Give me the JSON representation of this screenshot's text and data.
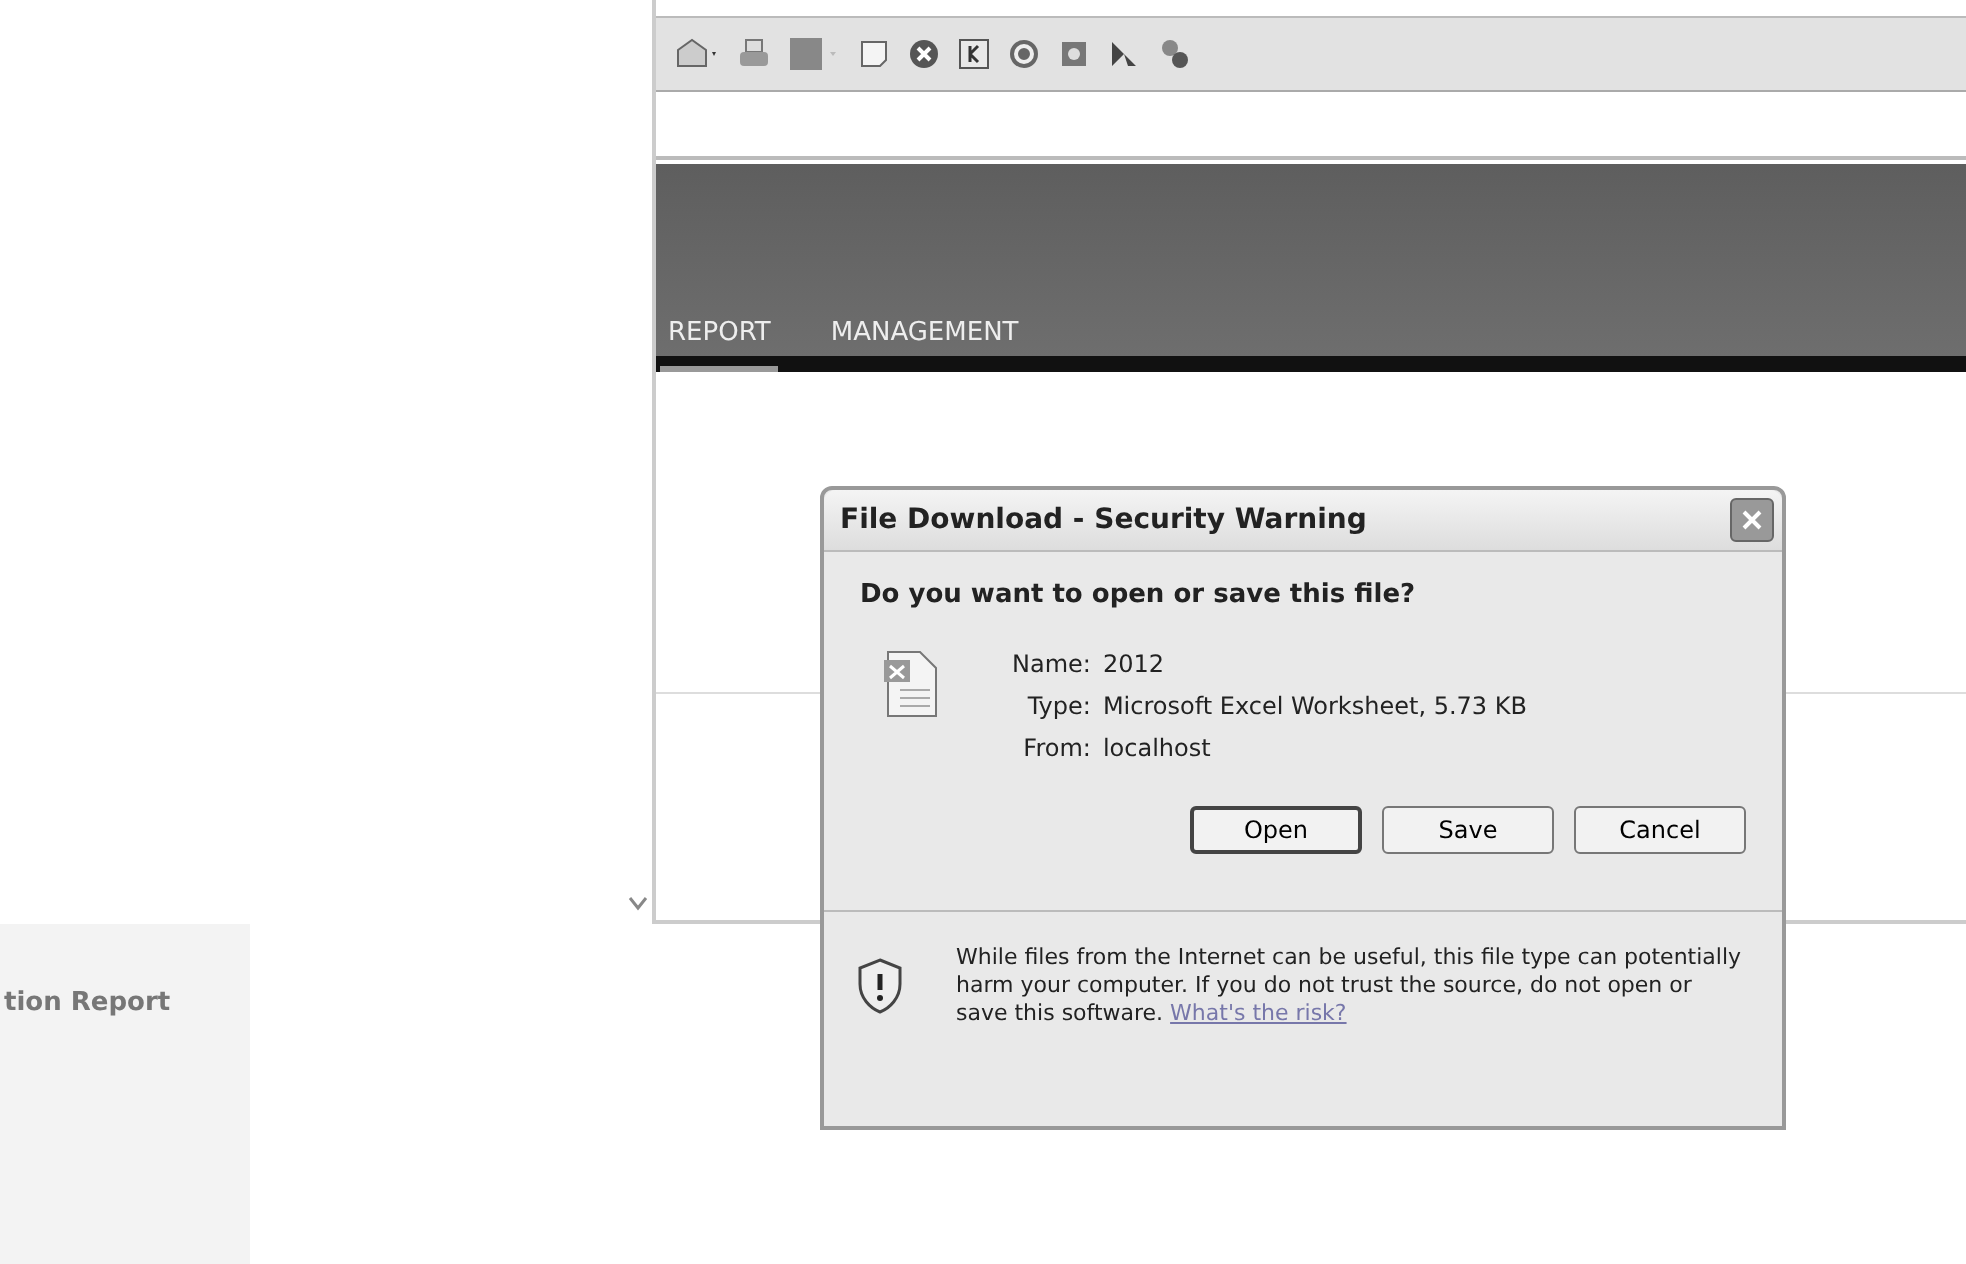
{
  "nav": {
    "items": [
      {
        "label": "REPORT",
        "selected": true
      },
      {
        "label": "MANAGEMENT",
        "selected": false
      }
    ]
  },
  "side_panel": {
    "heading": "tion Report"
  },
  "dialog": {
    "title": "File Download - Security Warning",
    "question": "Do you want to open or save this file?",
    "fields": [
      {
        "label": "Name:",
        "value": "2012"
      },
      {
        "label": "Type:",
        "value": "Microsoft Excel Worksheet, 5.73 KB"
      },
      {
        "label": "From:",
        "value": "localhost"
      }
    ],
    "buttons": [
      {
        "label": "Open",
        "default": true
      },
      {
        "label": "Save",
        "default": false
      },
      {
        "label": "Cancel",
        "default": false
      }
    ],
    "warning": "While files from the Internet can be useful, this file type can potentially harm your computer. If you do not trust the source, do not open or save this software.",
    "link": "What's the risk?"
  }
}
